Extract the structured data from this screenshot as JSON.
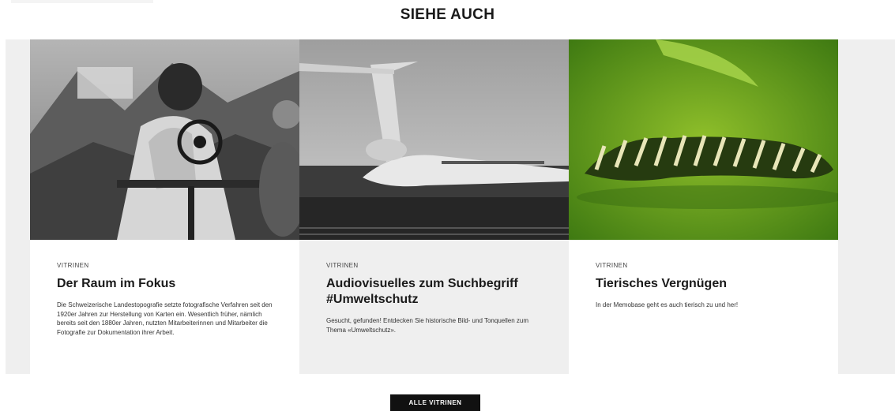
{
  "section": {
    "title": "SIEHE AUCH"
  },
  "cards": [
    {
      "category": "VITRINEN",
      "title": "Der Raum im Fokus",
      "text": "Die Schweizerische Landestopografie setzte fotografische Verfahren seit den 1920er Jahren zur Herstellung von Karten ein. Wesentlich früher, nämlich bereits seit den 1880er Jahren, nutzten Mitarbeiterinnen und Mitarbeiter die Fotografie zur Dokumentation ihrer Arbeit."
    },
    {
      "category": "VITRINEN",
      "title": "Audiovisuelles zum Suchbegriff #Umweltschutz",
      "text": "Gesucht, gefunden! Entdecken Sie historische Bild- und Tonquellen zum Thema «Umweltschutz»."
    },
    {
      "category": "VITRINEN",
      "title": "Tierisches Vergnügen",
      "text": "In der Memobase geht es auch tierisch zu und her!"
    }
  ],
  "cta": {
    "label": "ALLE VITRINEN"
  }
}
